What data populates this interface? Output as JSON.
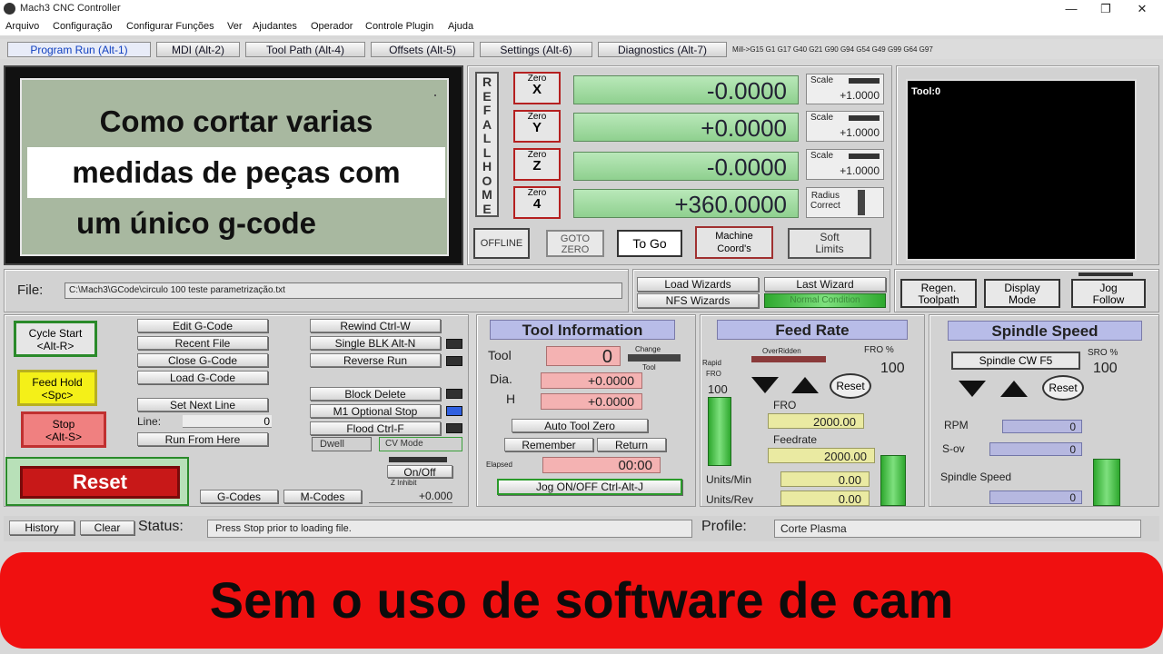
{
  "window": {
    "title": "Mach3 CNC Controller",
    "minimize": "—",
    "maximize": "❐",
    "close": "✕"
  },
  "menu": [
    "Arquivo",
    "Configuração",
    "Configurar Funções",
    "Ver",
    "Ajudantes",
    "Operador",
    "Controle Plugin",
    "Ajuda"
  ],
  "tabs": [
    "Program Run (Alt-1)",
    "MDI (Alt-2)",
    "Tool Path (Alt-4)",
    "Offsets (Alt-5)",
    "Settings (Alt-6)",
    "Diagnostics (Alt-7)"
  ],
  "modal_line": "Mill->G15  G1 G17 G40 G21 G90 G94 G54 G49 G99 G64 G97",
  "gcode_overlay": [
    "Como cortar varias",
    "medidas de peças com",
    "um único g-code"
  ],
  "ref_all_home": [
    "R",
    "E",
    "F",
    "A",
    "L",
    "L",
    "H",
    "O",
    "M",
    "E"
  ],
  "axes": [
    {
      "zero_top": "Zero",
      "zero_axis": "X",
      "value": "-0.0000",
      "scale_label": "Scale",
      "scale_value": "+1.0000"
    },
    {
      "zero_top": "Zero",
      "zero_axis": "Y",
      "value": "+0.0000",
      "scale_label": "Scale",
      "scale_value": "+1.0000"
    },
    {
      "zero_top": "Zero",
      "zero_axis": "Z",
      "value": "-0.0000",
      "scale_label": "Scale",
      "scale_value": "+1.0000"
    },
    {
      "zero_top": "Zero",
      "zero_axis": "4",
      "value": "+360.0000",
      "scale_label": "Radius",
      "scale_value": "Correct"
    }
  ],
  "dro_buttons": {
    "offline": "OFFLINE",
    "goto_zero_1": "GOTO",
    "goto_zero_2": "ZERO",
    "to_go": "To Go",
    "machine_coords_1": "Machine",
    "machine_coords_2": "Coord's",
    "soft_limits_1": "Soft",
    "soft_limits_2": "Limits"
  },
  "toolpath": {
    "tool_label": "Tool:0"
  },
  "file": {
    "label": "File:",
    "path": "C:\\Mach3\\GCode\\circulo 100 teste parametrização.txt"
  },
  "wizards": {
    "load": "Load Wizards",
    "last": "Last Wizard",
    "nfs": "NFS Wizards",
    "normal_condition": "Normal Condition"
  },
  "view_buttons": {
    "regen_1": "Regen.",
    "regen_2": "Toolpath",
    "display_1": "Display",
    "display_2": "Mode",
    "jog_1": "Jog",
    "jog_2": "Follow"
  },
  "program": {
    "cycle_start_1": "Cycle Start",
    "cycle_start_2": "<Alt-R>",
    "feed_hold_1": "Feed Hold",
    "feed_hold_2": "<Spc>",
    "stop_1": "Stop",
    "stop_2": "<Alt-S>",
    "edit_gcode": "Edit G-Code",
    "recent_file": "Recent File",
    "close_gcode": "Close G-Code",
    "load_gcode": "Load G-Code",
    "set_next_line": "Set Next Line",
    "line_label": "Line:",
    "line_value": "0",
    "run_from_here": "Run From Here",
    "rewind": "Rewind Ctrl-W",
    "single_blk": "Single BLK Alt-N",
    "reverse_run": "Reverse Run",
    "block_delete": "Block Delete",
    "m1_optional_stop": "M1 Optional Stop",
    "flood": "Flood Ctrl-F",
    "dwell": "Dwell",
    "cv_mode": "CV Mode",
    "reset": "Reset",
    "on_off": "On/Off",
    "z_inhibit": "Z Inhibit",
    "z_inhibit_value": "+0.000",
    "g_codes": "G-Codes",
    "m_codes": "M-Codes"
  },
  "tool_info": {
    "title": "Tool Information",
    "tool_label": "Tool",
    "tool_value": "0",
    "change_label": "Change",
    "tool_small": "Tool",
    "dia_label": "Dia.",
    "dia_value": "+0.0000",
    "h_label": "H",
    "h_value": "+0.0000",
    "auto_tool_zero": "Auto Tool Zero",
    "remember": "Remember",
    "return": "Return",
    "elapsed_label": "Elapsed",
    "elapsed_value": "00:00",
    "jog_onoff": "Jog ON/OFF Ctrl-Alt-J"
  },
  "feed_rate": {
    "title": "Feed Rate",
    "overridden": "OverRidden",
    "fro_pct_label": "FRO %",
    "fro_pct_value": "100",
    "rapid_label": "Rapid",
    "rapid_fro_label": "FRO",
    "rapid_value": "100",
    "reset": "Reset",
    "fro_label": "FRO",
    "fro_value": "2000.00",
    "feedrate_label": "Feedrate",
    "feedrate_value": "2000.00",
    "units_min_label": "Units/Min",
    "units_min_value": "0.00",
    "units_rev_label": "Units/Rev",
    "units_rev_value": "0.00"
  },
  "spindle": {
    "title": "Spindle Speed",
    "cw_button": "Spindle CW F5",
    "sro_label": "SRO %",
    "sro_value": "100",
    "reset": "Reset",
    "rpm_label": "RPM",
    "rpm_value": "0",
    "sov_label": "S-ov",
    "sov_value": "0",
    "speed_label": "Spindle Speed",
    "speed_value": "0"
  },
  "statusbar": {
    "history": "History",
    "clear": "Clear",
    "status_label": "Status:",
    "status_text": "Press Stop prior to loading file.",
    "profile_label": "Profile:",
    "profile_value": "Corte Plasma"
  },
  "banner": "Sem o uso de software de cam",
  "colors": {
    "reset_red": "#c81818",
    "dro_green": "#9fd89f",
    "banner_red": "#f01010",
    "header_blue": "#b8bce8"
  }
}
